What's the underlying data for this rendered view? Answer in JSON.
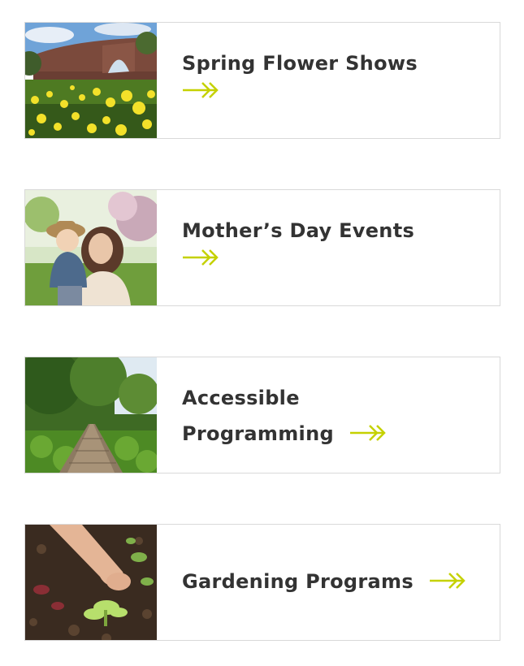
{
  "cards": [
    {
      "title": "Spring Flower Shows",
      "arrow_icon": "double-chevron-arrow-icon",
      "image": "walled-garden-daffodils-photo"
    },
    {
      "title_line1": "Mother’s Day Events",
      "arrow_icon": "double-chevron-arrow-icon",
      "image": "mother-and-child-photo"
    },
    {
      "title_line1": "Accessible",
      "title_line2": "Programming",
      "arrow_icon": "double-chevron-arrow-icon",
      "image": "woodland-boardwalk-photo"
    },
    {
      "title": "Gardening Programs",
      "arrow_icon": "double-chevron-arrow-icon",
      "image": "hand-planting-seedling-photo"
    }
  ],
  "colors": {
    "accent_arrow": "#c5d100",
    "text": "#333333",
    "border": "#d9d9d9"
  }
}
